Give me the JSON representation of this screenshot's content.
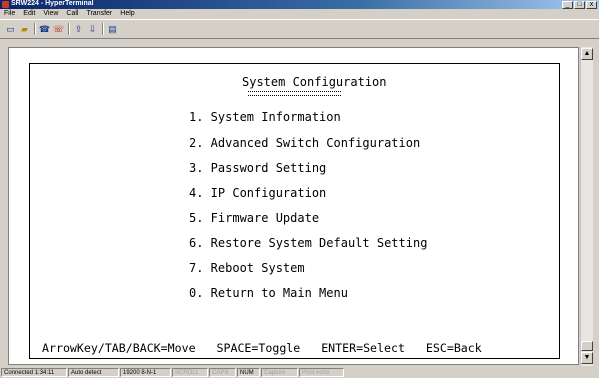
{
  "window": {
    "title": "SRW224 - HyperTerminal",
    "controls": {
      "minimize": "_",
      "maximize": "□",
      "close": "x"
    }
  },
  "menubar": [
    "File",
    "Edit",
    "View",
    "Call",
    "Transfer",
    "Help"
  ],
  "toolbar": {
    "icons": [
      "new-icon",
      "open-icon",
      "connect-icon",
      "disconnect-icon",
      "send-icon",
      "receive-icon",
      "properties-icon"
    ]
  },
  "terminal": {
    "heading": "System Configuration",
    "items": [
      "1. System Information",
      "2. Advanced Switch Configuration",
      "3. Password Setting",
      "4. IP Configuration",
      "5. Firmware Update",
      "6. Restore System Default Setting",
      "7. Reboot System",
      "0. Return to Main Menu"
    ],
    "footer": "ArrowKey/TAB/BACK=Move   SPACE=Toggle   ENTER=Select   ESC=Back"
  },
  "statusbar": {
    "connected": "Connected 1:34:11",
    "detect": "Auto detect",
    "settings": "19200 8-N-1",
    "scroll": "SCROLL",
    "caps": "CAPS",
    "num": "NUM",
    "capture": "Capture",
    "print_echo": "Print echo"
  },
  "colors": {
    "titlebar": "#0a246a",
    "window_bg": "#d4d0c8",
    "screen_bg": "#ffffff"
  }
}
